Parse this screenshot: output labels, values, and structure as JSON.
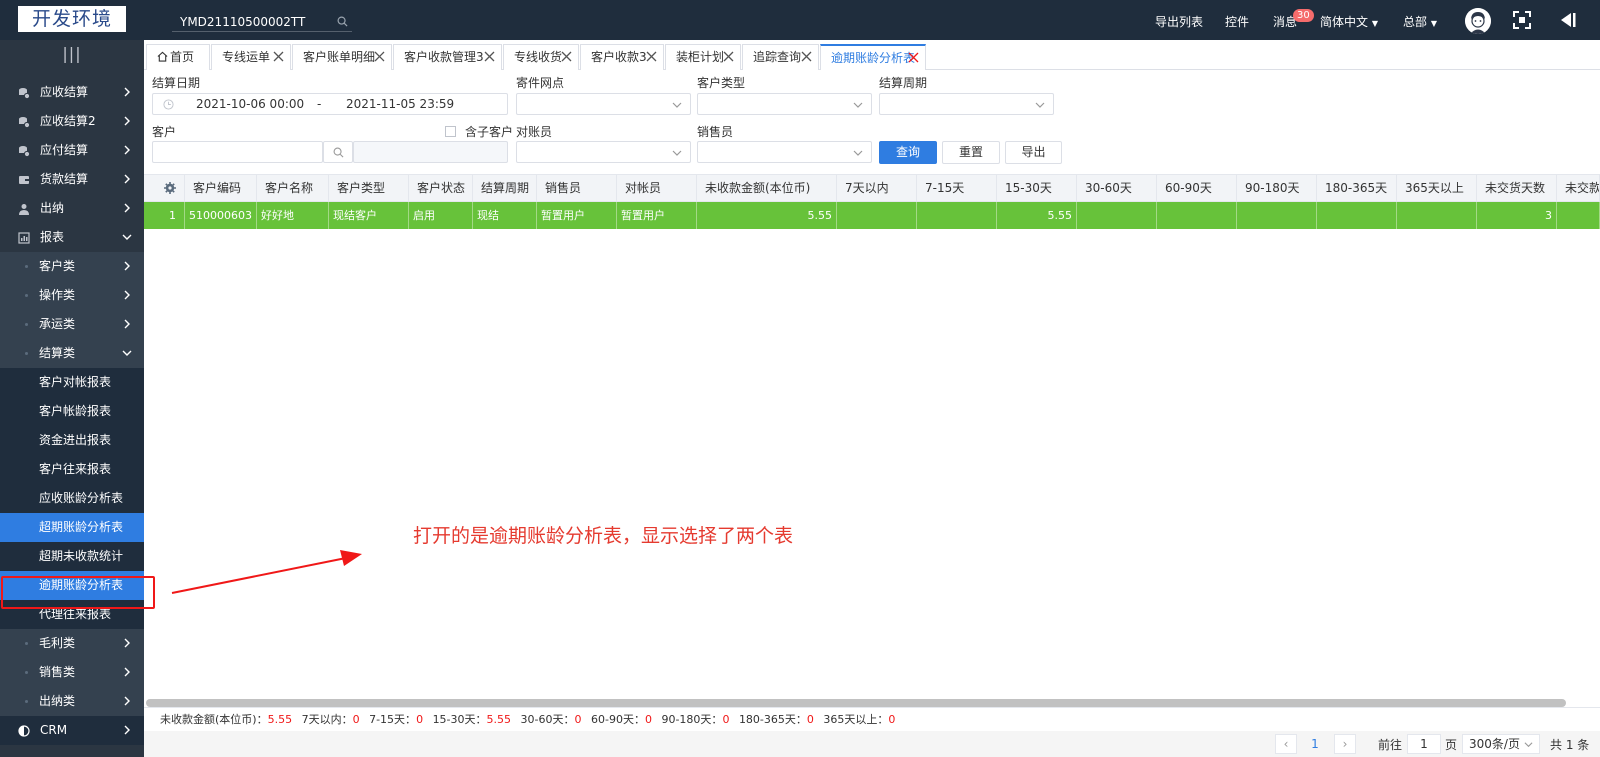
{
  "header": {
    "logo_text": "开发环境",
    "search_value": "YMD21110500002TT",
    "export_list": "导出列表",
    "plugins": "控件",
    "messages": "消息",
    "message_count": "30",
    "language": "简体中文",
    "org": "总部"
  },
  "sidebar": {
    "toggle": "|||",
    "items": [
      {
        "label": "应收结算"
      },
      {
        "label": "应收结算2"
      },
      {
        "label": "应付结算"
      },
      {
        "label": "货款结算"
      },
      {
        "label": "出纳"
      },
      {
        "label": "报表"
      }
    ],
    "report_sub": [
      {
        "label": "客户类"
      },
      {
        "label": "操作类"
      },
      {
        "label": "承运类"
      },
      {
        "label": "结算类"
      }
    ],
    "settlement_leaves": [
      {
        "label": "客户对帐报表"
      },
      {
        "label": "客户帐龄报表"
      },
      {
        "label": "资金进出报表"
      },
      {
        "label": "客户往来报表"
      },
      {
        "label": "应收账龄分析表"
      },
      {
        "label": "超期账龄分析表"
      },
      {
        "label": "超期未收款统计"
      },
      {
        "label": "逾期账龄分析表"
      },
      {
        "label": "代理往来报表"
      }
    ],
    "report_sub_after": [
      {
        "label": "毛利类"
      },
      {
        "label": "销售类"
      },
      {
        "label": "出纳类"
      }
    ],
    "crm": "CRM"
  },
  "tabs": [
    {
      "label": "首页"
    },
    {
      "label": "专线运单"
    },
    {
      "label": "客户账单明细"
    },
    {
      "label": "客户收款管理3"
    },
    {
      "label": "专线收货"
    },
    {
      "label": "客户收款3"
    },
    {
      "label": "装柜计划"
    },
    {
      "label": "追踪查询"
    },
    {
      "label": "逾期账龄分析表"
    }
  ],
  "filters": {
    "settle_date_label": "结算日期",
    "date_start": "2021-10-06 00:00",
    "date_sep": "-",
    "date_end": "2021-11-05 23:59",
    "send_point_label": "寄件网点",
    "customer_type_label": "客户类型",
    "settle_cycle_label": "结算周期",
    "customer_label": "客户",
    "include_sub_label": "含子客户",
    "reconciler_label": "对账员",
    "salesperson_label": "销售员",
    "query_button": "查询",
    "reset_button": "重置",
    "export_button": "导出"
  },
  "table": {
    "columns": [
      "客户编码",
      "客户名称",
      "客户类型",
      "客户状态",
      "结算周期",
      "销售员",
      "对帐员",
      "未收款金额(本位币)",
      "7天以内",
      "7-15天",
      "15-30天",
      "30-60天",
      "60-90天",
      "90-180天",
      "180-365天",
      "365天以上",
      "未交货天数",
      "未交款天"
    ],
    "rows": [
      {
        "index": "1",
        "cells": [
          "510000603",
          "好好地",
          "现结客户",
          "启用",
          "现结",
          "暂置用户",
          "暂置用户",
          "5.55",
          "",
          "",
          "5.55",
          "",
          "",
          "",
          "",
          "",
          "3",
          ""
        ]
      }
    ]
  },
  "annotation": "打开的是逾期账龄分析表，显示选择了两个表",
  "summary": [
    {
      "label": "未收款金额(本位币)：",
      "value": "5.55"
    },
    {
      "label": "7天以内：",
      "value": "0"
    },
    {
      "label": "7-15天：",
      "value": "0"
    },
    {
      "label": "15-30天：",
      "value": "5.55"
    },
    {
      "label": "30-60天：",
      "value": "0"
    },
    {
      "label": "60-90天：",
      "value": "0"
    },
    {
      "label": "90-180天：",
      "value": "0"
    },
    {
      "label": "180-365天：",
      "value": "0"
    },
    {
      "label": "365天以上：",
      "value": "0"
    }
  ],
  "pager": {
    "current_page": "1",
    "goto_label": "前往",
    "goto_value": "1",
    "page_unit": "页",
    "page_size": "300条/页",
    "total": "共 1 条"
  }
}
